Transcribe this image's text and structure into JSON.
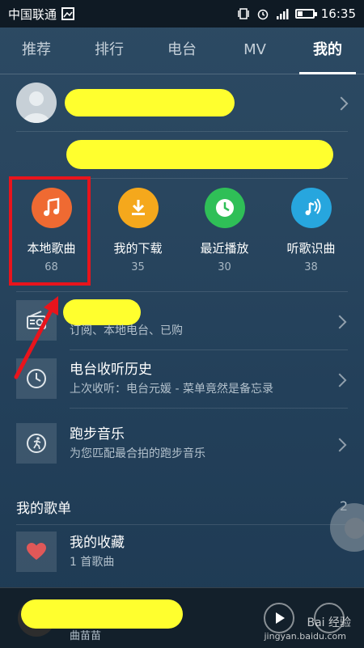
{
  "status": {
    "carrier": "中国联通",
    "time": "16:35"
  },
  "tabs": [
    {
      "label": "推荐"
    },
    {
      "label": "排行"
    },
    {
      "label": "电台"
    },
    {
      "label": "MV"
    },
    {
      "label": "我的",
      "active": true
    }
  ],
  "quick": [
    {
      "label": "本地歌曲",
      "count": "68",
      "color": "#ef6a32",
      "icon": "music-note-icon"
    },
    {
      "label": "我的下载",
      "count": "35",
      "color": "#f5a81c",
      "icon": "download-icon"
    },
    {
      "label": "最近播放",
      "count": "30",
      "color": "#2fbf57",
      "icon": "clock-icon"
    },
    {
      "label": "听歌识曲",
      "count": "38",
      "color": "#27a6de",
      "icon": "music-recognize-icon"
    }
  ],
  "rows": [
    {
      "title": "",
      "subtitle": "订阅、本地电台、已购",
      "icon": "radio-icon"
    },
    {
      "title": "电台收听历史",
      "subtitle": "上次收听：电台元媛 - 菜单竟然是备忘录",
      "icon": "clock-icon"
    },
    {
      "title": "跑步音乐",
      "subtitle": "为您匹配最合拍的跑步音乐",
      "icon": "running-icon"
    }
  ],
  "playlists": {
    "header": "我的歌单",
    "count": "2",
    "items": [
      {
        "title": "我的收藏",
        "subtitle": "1 首歌曲",
        "icon": "heart-icon"
      }
    ]
  },
  "player": {
    "artist": "曲苗苗"
  },
  "watermark": {
    "line1": "Bai 经验",
    "line2": "jingyan.baidu.com"
  },
  "colors": {
    "highlight": "#ffff2e",
    "annotation_red": "#e8141c"
  }
}
